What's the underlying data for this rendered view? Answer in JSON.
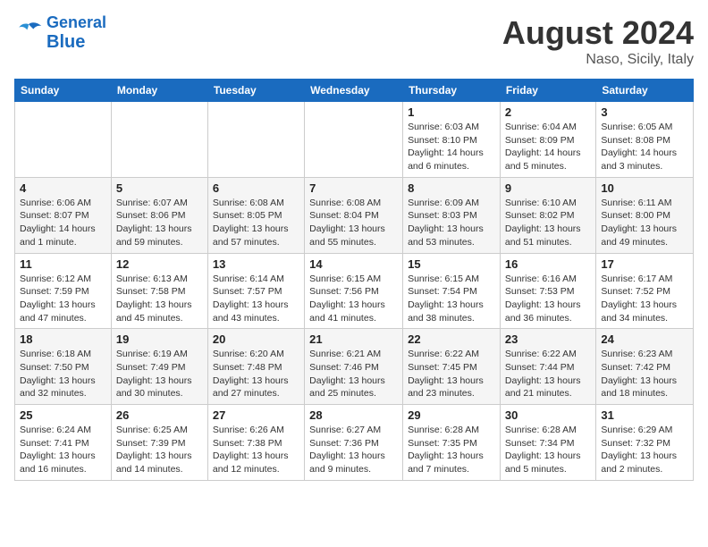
{
  "header": {
    "logo_line1": "General",
    "logo_line2": "Blue",
    "title": "August 2024",
    "subtitle": "Naso, Sicily, Italy"
  },
  "days_of_week": [
    "Sunday",
    "Monday",
    "Tuesday",
    "Wednesday",
    "Thursday",
    "Friday",
    "Saturday"
  ],
  "weeks": [
    [
      {
        "day": "",
        "info": ""
      },
      {
        "day": "",
        "info": ""
      },
      {
        "day": "",
        "info": ""
      },
      {
        "day": "",
        "info": ""
      },
      {
        "day": "1",
        "info": "Sunrise: 6:03 AM\nSunset: 8:10 PM\nDaylight: 14 hours\nand 6 minutes."
      },
      {
        "day": "2",
        "info": "Sunrise: 6:04 AM\nSunset: 8:09 PM\nDaylight: 14 hours\nand 5 minutes."
      },
      {
        "day": "3",
        "info": "Sunrise: 6:05 AM\nSunset: 8:08 PM\nDaylight: 14 hours\nand 3 minutes."
      }
    ],
    [
      {
        "day": "4",
        "info": "Sunrise: 6:06 AM\nSunset: 8:07 PM\nDaylight: 14 hours\nand 1 minute."
      },
      {
        "day": "5",
        "info": "Sunrise: 6:07 AM\nSunset: 8:06 PM\nDaylight: 13 hours\nand 59 minutes."
      },
      {
        "day": "6",
        "info": "Sunrise: 6:08 AM\nSunset: 8:05 PM\nDaylight: 13 hours\nand 57 minutes."
      },
      {
        "day": "7",
        "info": "Sunrise: 6:08 AM\nSunset: 8:04 PM\nDaylight: 13 hours\nand 55 minutes."
      },
      {
        "day": "8",
        "info": "Sunrise: 6:09 AM\nSunset: 8:03 PM\nDaylight: 13 hours\nand 53 minutes."
      },
      {
        "day": "9",
        "info": "Sunrise: 6:10 AM\nSunset: 8:02 PM\nDaylight: 13 hours\nand 51 minutes."
      },
      {
        "day": "10",
        "info": "Sunrise: 6:11 AM\nSunset: 8:00 PM\nDaylight: 13 hours\nand 49 minutes."
      }
    ],
    [
      {
        "day": "11",
        "info": "Sunrise: 6:12 AM\nSunset: 7:59 PM\nDaylight: 13 hours\nand 47 minutes."
      },
      {
        "day": "12",
        "info": "Sunrise: 6:13 AM\nSunset: 7:58 PM\nDaylight: 13 hours\nand 45 minutes."
      },
      {
        "day": "13",
        "info": "Sunrise: 6:14 AM\nSunset: 7:57 PM\nDaylight: 13 hours\nand 43 minutes."
      },
      {
        "day": "14",
        "info": "Sunrise: 6:15 AM\nSunset: 7:56 PM\nDaylight: 13 hours\nand 41 minutes."
      },
      {
        "day": "15",
        "info": "Sunrise: 6:15 AM\nSunset: 7:54 PM\nDaylight: 13 hours\nand 38 minutes."
      },
      {
        "day": "16",
        "info": "Sunrise: 6:16 AM\nSunset: 7:53 PM\nDaylight: 13 hours\nand 36 minutes."
      },
      {
        "day": "17",
        "info": "Sunrise: 6:17 AM\nSunset: 7:52 PM\nDaylight: 13 hours\nand 34 minutes."
      }
    ],
    [
      {
        "day": "18",
        "info": "Sunrise: 6:18 AM\nSunset: 7:50 PM\nDaylight: 13 hours\nand 32 minutes."
      },
      {
        "day": "19",
        "info": "Sunrise: 6:19 AM\nSunset: 7:49 PM\nDaylight: 13 hours\nand 30 minutes."
      },
      {
        "day": "20",
        "info": "Sunrise: 6:20 AM\nSunset: 7:48 PM\nDaylight: 13 hours\nand 27 minutes."
      },
      {
        "day": "21",
        "info": "Sunrise: 6:21 AM\nSunset: 7:46 PM\nDaylight: 13 hours\nand 25 minutes."
      },
      {
        "day": "22",
        "info": "Sunrise: 6:22 AM\nSunset: 7:45 PM\nDaylight: 13 hours\nand 23 minutes."
      },
      {
        "day": "23",
        "info": "Sunrise: 6:22 AM\nSunset: 7:44 PM\nDaylight: 13 hours\nand 21 minutes."
      },
      {
        "day": "24",
        "info": "Sunrise: 6:23 AM\nSunset: 7:42 PM\nDaylight: 13 hours\nand 18 minutes."
      }
    ],
    [
      {
        "day": "25",
        "info": "Sunrise: 6:24 AM\nSunset: 7:41 PM\nDaylight: 13 hours\nand 16 minutes."
      },
      {
        "day": "26",
        "info": "Sunrise: 6:25 AM\nSunset: 7:39 PM\nDaylight: 13 hours\nand 14 minutes."
      },
      {
        "day": "27",
        "info": "Sunrise: 6:26 AM\nSunset: 7:38 PM\nDaylight: 13 hours\nand 12 minutes."
      },
      {
        "day": "28",
        "info": "Sunrise: 6:27 AM\nSunset: 7:36 PM\nDaylight: 13 hours\nand 9 minutes."
      },
      {
        "day": "29",
        "info": "Sunrise: 6:28 AM\nSunset: 7:35 PM\nDaylight: 13 hours\nand 7 minutes."
      },
      {
        "day": "30",
        "info": "Sunrise: 6:28 AM\nSunset: 7:34 PM\nDaylight: 13 hours\nand 5 minutes."
      },
      {
        "day": "31",
        "info": "Sunrise: 6:29 AM\nSunset: 7:32 PM\nDaylight: 13 hours\nand 2 minutes."
      }
    ]
  ]
}
